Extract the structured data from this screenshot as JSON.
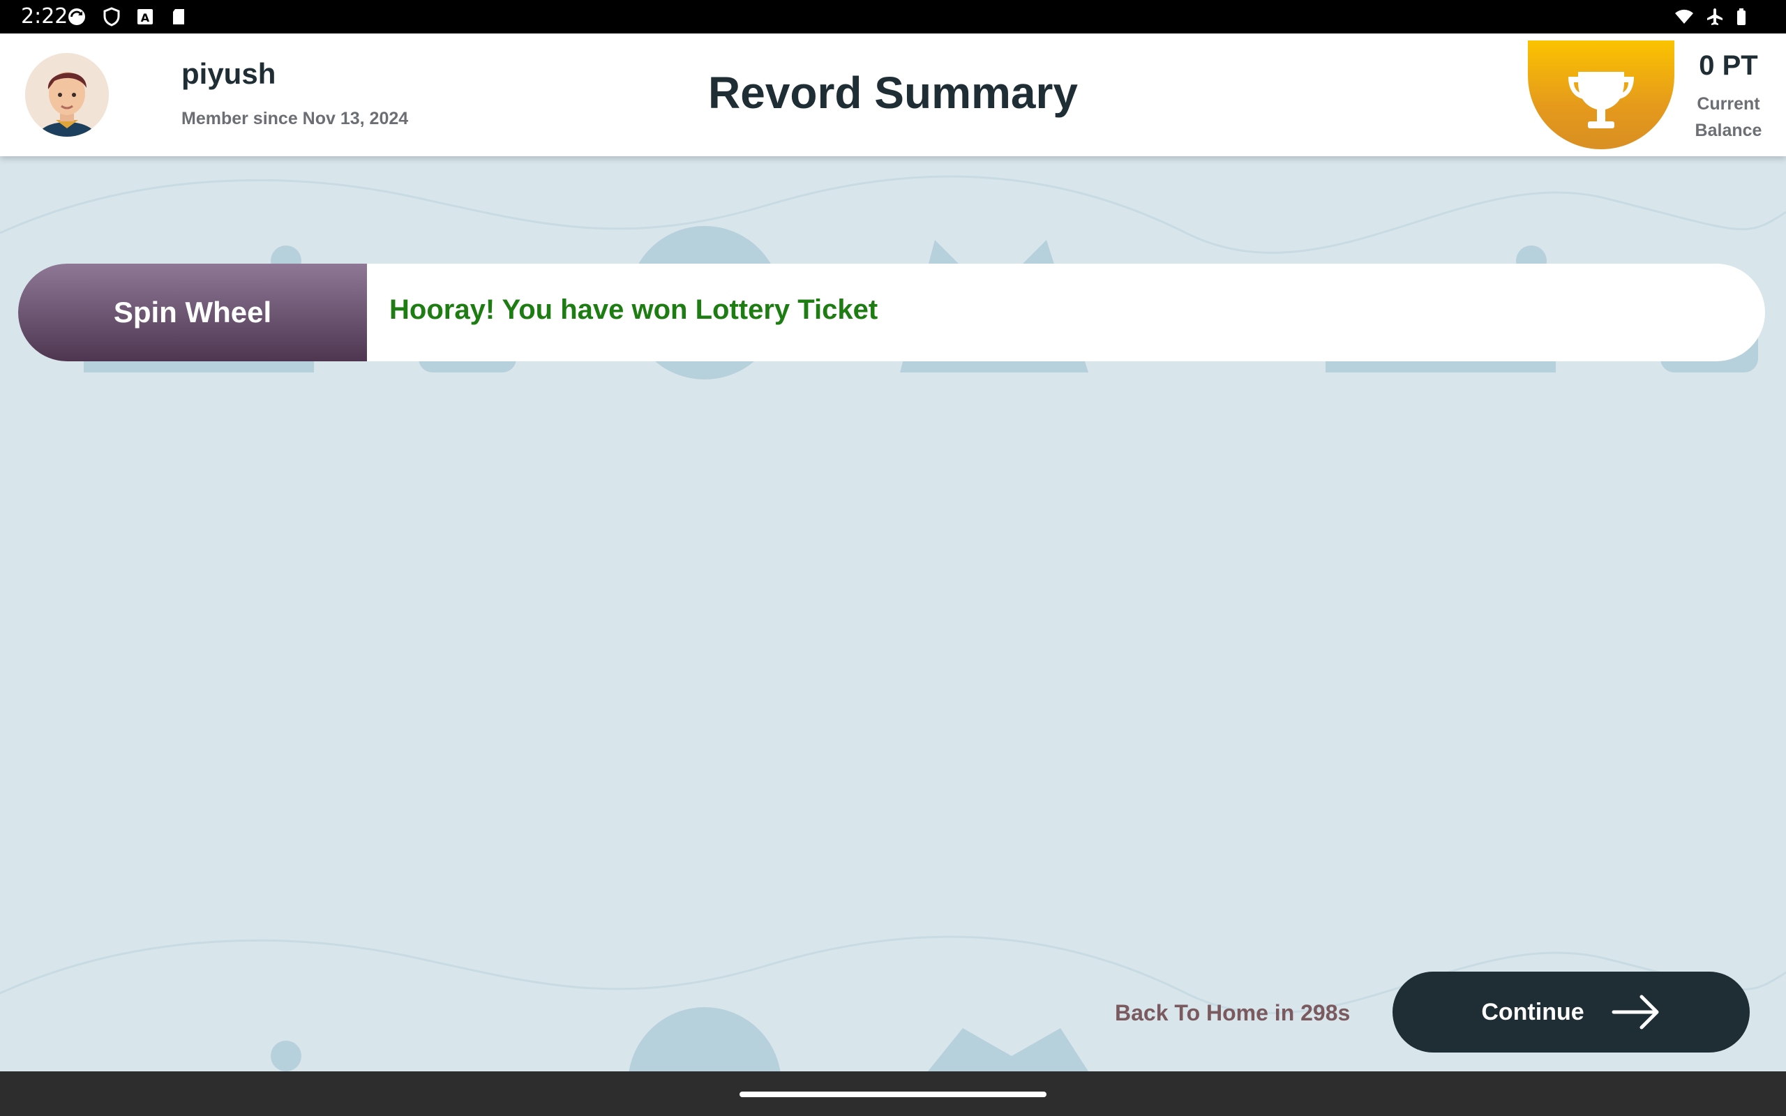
{
  "status_bar": {
    "time": "2:22",
    "icons": [
      "sync-icon",
      "shield-icon",
      "font-icon",
      "sd-card-icon",
      "wifi-icon",
      "airplane-icon",
      "battery-icon"
    ]
  },
  "header": {
    "user_name": "piyush",
    "member_since": "Member since Nov 13, 2024",
    "title": "Revord Summary",
    "balance_value": "0 PT",
    "balance_label_line1": "Current",
    "balance_label_line2": "Balance"
  },
  "result": {
    "game_label": "Spin Wheel",
    "message": "Hooray! You have won Lottery Ticket"
  },
  "footer": {
    "back_home": "Back To Home in 298s",
    "continue_label": "Continue"
  },
  "colors": {
    "header_text": "#1f2d35",
    "success_text": "#1d7d12",
    "accent_gold": "#fbc300",
    "game_tag": "#6a5470",
    "background": "#d8e6ec"
  }
}
